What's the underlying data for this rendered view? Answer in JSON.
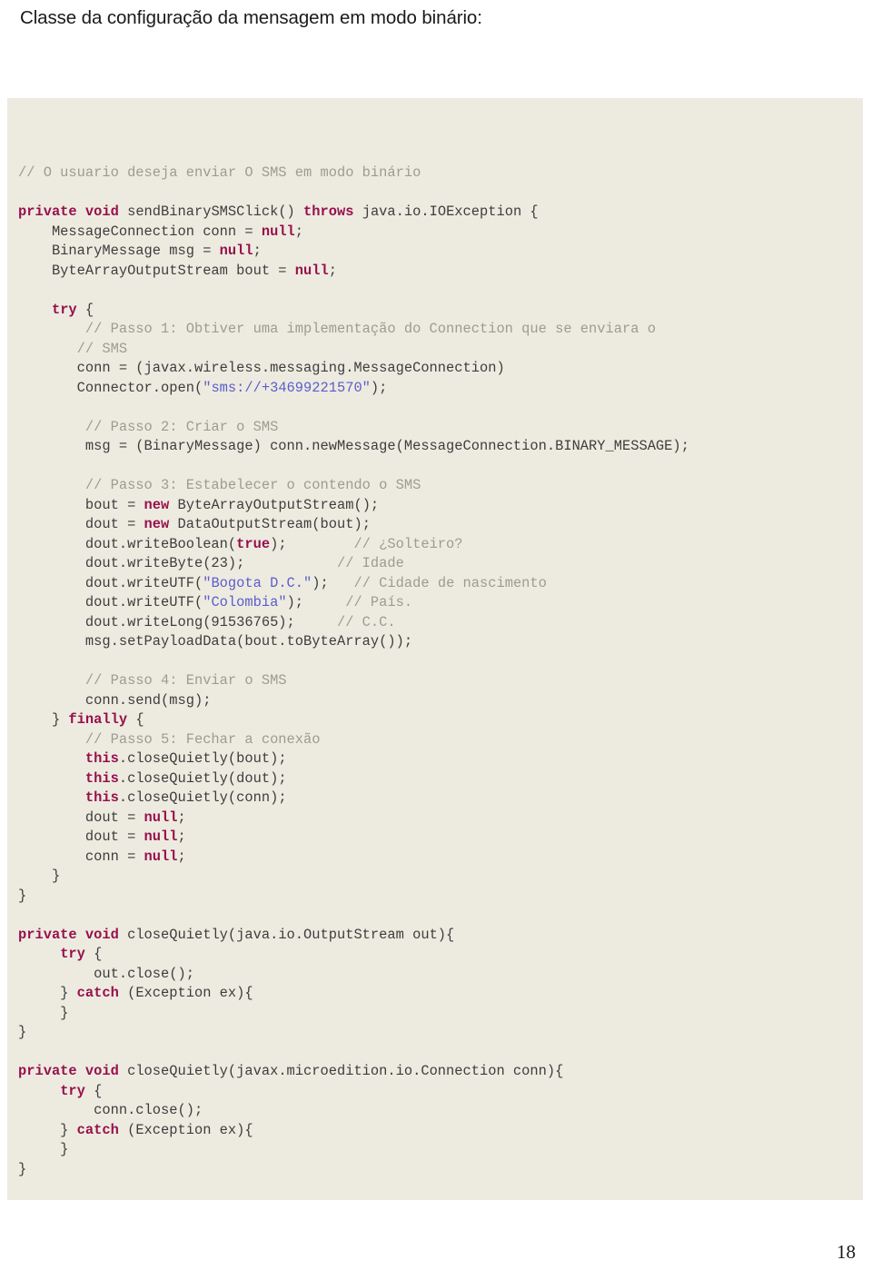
{
  "page": {
    "title": "Classe da configuração da mensagem em modo binário:",
    "number": "18"
  },
  "colors": {
    "code_background": "#edebe0",
    "keyword": "#97104c",
    "comment": "#9b9c92",
    "string": "#5c5ccc",
    "plain": "#3d3d3d",
    "page_background": "#ffffff"
  },
  "code": {
    "language": "java",
    "lines": [
      {
        "tokens": [
          {
            "t": "// O usuario deseja enviar O SMS em modo binário",
            "c": "cm"
          }
        ]
      },
      {
        "tokens": []
      },
      {
        "tokens": [
          {
            "t": "private void",
            "c": "kw"
          },
          {
            "t": " sendBinarySMSClick() ",
            "c": "pl"
          },
          {
            "t": "throws",
            "c": "kw"
          },
          {
            "t": " java.io.IOException {",
            "c": "pl"
          }
        ]
      },
      {
        "tokens": [
          {
            "t": "    MessageConnection conn = ",
            "c": "pl"
          },
          {
            "t": "null",
            "c": "kw"
          },
          {
            "t": ";",
            "c": "pl"
          }
        ]
      },
      {
        "tokens": [
          {
            "t": "    BinaryMessage msg = ",
            "c": "pl"
          },
          {
            "t": "null",
            "c": "kw"
          },
          {
            "t": ";",
            "c": "pl"
          }
        ]
      },
      {
        "tokens": [
          {
            "t": "    ByteArrayOutputStream bout = ",
            "c": "pl"
          },
          {
            "t": "null",
            "c": "kw"
          },
          {
            "t": ";",
            "c": "pl"
          }
        ]
      },
      {
        "tokens": []
      },
      {
        "tokens": [
          {
            "t": "    ",
            "c": "pl"
          },
          {
            "t": "try",
            "c": "kw"
          },
          {
            "t": " {",
            "c": "pl"
          }
        ]
      },
      {
        "tokens": [
          {
            "t": "        // Passo 1: Obtiver uma implementação do Connection que se enviara o",
            "c": "cm"
          }
        ]
      },
      {
        "tokens": [
          {
            "t": "       // SMS",
            "c": "cm"
          }
        ]
      },
      {
        "tokens": [
          {
            "t": "       conn = (javax.wireless.messaging.MessageConnection)",
            "c": "pl"
          }
        ]
      },
      {
        "tokens": [
          {
            "t": "       Connector.open(",
            "c": "pl"
          },
          {
            "t": "\"sms://+34699221570\"",
            "c": "st"
          },
          {
            "t": ");",
            "c": "pl"
          }
        ]
      },
      {
        "tokens": []
      },
      {
        "tokens": [
          {
            "t": "        // Passo 2: Criar o SMS",
            "c": "cm"
          }
        ]
      },
      {
        "tokens": [
          {
            "t": "        msg = (BinaryMessage) conn.newMessage(MessageConnection.BINARY_MESSAGE);",
            "c": "pl"
          }
        ]
      },
      {
        "tokens": []
      },
      {
        "tokens": [
          {
            "t": "        // Passo 3: Estabelecer o contendo o SMS",
            "c": "cm"
          }
        ]
      },
      {
        "tokens": [
          {
            "t": "        bout = ",
            "c": "pl"
          },
          {
            "t": "new",
            "c": "kw"
          },
          {
            "t": " ByteArrayOutputStream();",
            "c": "pl"
          }
        ]
      },
      {
        "tokens": [
          {
            "t": "        dout = ",
            "c": "pl"
          },
          {
            "t": "new",
            "c": "kw"
          },
          {
            "t": " DataOutputStream(bout);",
            "c": "pl"
          }
        ]
      },
      {
        "tokens": [
          {
            "t": "        dout.writeBoolean(",
            "c": "pl"
          },
          {
            "t": "true",
            "c": "kw"
          },
          {
            "t": ");        ",
            "c": "pl"
          },
          {
            "t": "// ¿Solteiro?",
            "c": "cm"
          }
        ]
      },
      {
        "tokens": [
          {
            "t": "        dout.writeByte(23);           ",
            "c": "pl"
          },
          {
            "t": "// Idade",
            "c": "cm"
          }
        ]
      },
      {
        "tokens": [
          {
            "t": "        dout.writeUTF(",
            "c": "pl"
          },
          {
            "t": "\"Bogota D.C.\"",
            "c": "st"
          },
          {
            "t": ");   ",
            "c": "pl"
          },
          {
            "t": "// Cidade de nascimento",
            "c": "cm"
          }
        ]
      },
      {
        "tokens": [
          {
            "t": "        dout.writeUTF(",
            "c": "pl"
          },
          {
            "t": "\"Colombia\"",
            "c": "st"
          },
          {
            "t": ");     ",
            "c": "pl"
          },
          {
            "t": "// País.",
            "c": "cm"
          }
        ]
      },
      {
        "tokens": [
          {
            "t": "        dout.writeLong(91536765);     ",
            "c": "pl"
          },
          {
            "t": "// C.C.",
            "c": "cm"
          }
        ]
      },
      {
        "tokens": [
          {
            "t": "        msg.setPayloadData(bout.toByteArray());",
            "c": "pl"
          }
        ]
      },
      {
        "tokens": []
      },
      {
        "tokens": [
          {
            "t": "        // Passo 4: Enviar o SMS",
            "c": "cm"
          }
        ]
      },
      {
        "tokens": [
          {
            "t": "        conn.send(msg);",
            "c": "pl"
          }
        ]
      },
      {
        "tokens": [
          {
            "t": "    } ",
            "c": "pl"
          },
          {
            "t": "finally",
            "c": "kw"
          },
          {
            "t": " {",
            "c": "pl"
          }
        ]
      },
      {
        "tokens": [
          {
            "t": "        // Passo 5: Fechar a conexão",
            "c": "cm"
          }
        ]
      },
      {
        "tokens": [
          {
            "t": "        ",
            "c": "pl"
          },
          {
            "t": "this",
            "c": "kw"
          },
          {
            "t": ".closeQuietly(bout);",
            "c": "pl"
          }
        ]
      },
      {
        "tokens": [
          {
            "t": "        ",
            "c": "pl"
          },
          {
            "t": "this",
            "c": "kw"
          },
          {
            "t": ".closeQuietly(dout);",
            "c": "pl"
          }
        ]
      },
      {
        "tokens": [
          {
            "t": "        ",
            "c": "pl"
          },
          {
            "t": "this",
            "c": "kw"
          },
          {
            "t": ".closeQuietly(conn);",
            "c": "pl"
          }
        ]
      },
      {
        "tokens": [
          {
            "t": "        dout = ",
            "c": "pl"
          },
          {
            "t": "null",
            "c": "kw"
          },
          {
            "t": ";",
            "c": "pl"
          }
        ]
      },
      {
        "tokens": [
          {
            "t": "        dout = ",
            "c": "pl"
          },
          {
            "t": "null",
            "c": "kw"
          },
          {
            "t": ";",
            "c": "pl"
          }
        ]
      },
      {
        "tokens": [
          {
            "t": "        conn = ",
            "c": "pl"
          },
          {
            "t": "null",
            "c": "kw"
          },
          {
            "t": ";",
            "c": "pl"
          }
        ]
      },
      {
        "tokens": [
          {
            "t": "    }",
            "c": "pl"
          }
        ]
      },
      {
        "tokens": [
          {
            "t": "}",
            "c": "pl"
          }
        ]
      },
      {
        "tokens": []
      },
      {
        "tokens": [
          {
            "t": "private void",
            "c": "kw"
          },
          {
            "t": " closeQuietly(java.io.OutputStream out){",
            "c": "pl"
          }
        ]
      },
      {
        "tokens": [
          {
            "t": "     ",
            "c": "pl"
          },
          {
            "t": "try",
            "c": "kw"
          },
          {
            "t": " {",
            "c": "pl"
          }
        ]
      },
      {
        "tokens": [
          {
            "t": "         out.close();",
            "c": "pl"
          }
        ]
      },
      {
        "tokens": [
          {
            "t": "     } ",
            "c": "pl"
          },
          {
            "t": "catch",
            "c": "kw"
          },
          {
            "t": " (Exception ex){",
            "c": "pl"
          }
        ]
      },
      {
        "tokens": [
          {
            "t": "     }",
            "c": "pl"
          }
        ]
      },
      {
        "tokens": [
          {
            "t": "}",
            "c": "pl"
          }
        ]
      },
      {
        "tokens": []
      },
      {
        "tokens": [
          {
            "t": "private void",
            "c": "kw"
          },
          {
            "t": " closeQuietly(javax.microedition.io.Connection conn){",
            "c": "pl"
          }
        ]
      },
      {
        "tokens": [
          {
            "t": "     ",
            "c": "pl"
          },
          {
            "t": "try",
            "c": "kw"
          },
          {
            "t": " {",
            "c": "pl"
          }
        ]
      },
      {
        "tokens": [
          {
            "t": "         conn.close();",
            "c": "pl"
          }
        ]
      },
      {
        "tokens": [
          {
            "t": "     } ",
            "c": "pl"
          },
          {
            "t": "catch",
            "c": "kw"
          },
          {
            "t": " (Exception ex){",
            "c": "pl"
          }
        ]
      },
      {
        "tokens": [
          {
            "t": "     }",
            "c": "pl"
          }
        ]
      },
      {
        "tokens": [
          {
            "t": "}",
            "c": "pl"
          }
        ]
      }
    ]
  }
}
